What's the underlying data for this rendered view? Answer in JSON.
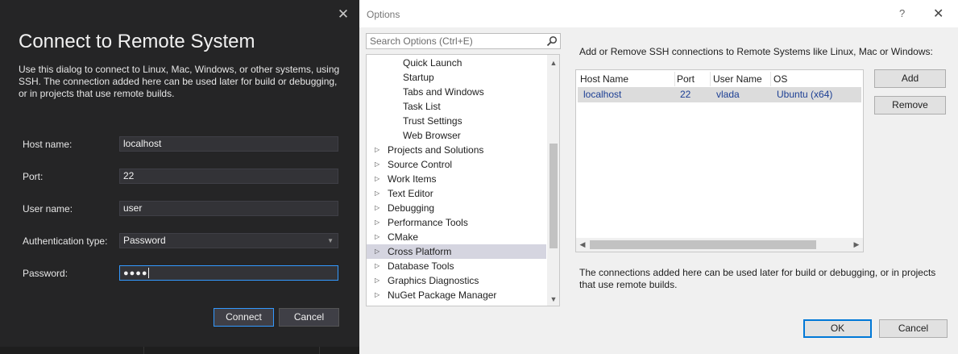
{
  "connect_dialog": {
    "close_glyph": "✕",
    "title": "Connect to Remote System",
    "description": "Use this dialog to connect to Linux, Mac, Windows, or other systems, using SSH. The connection added here can be used later for build or debugging, or in projects that use remote builds.",
    "fields": {
      "host_label": "Host name:",
      "host_value": "localhost",
      "port_label": "Port:",
      "port_value": "22",
      "user_label": "User name:",
      "user_value": "user",
      "auth_label": "Authentication type:",
      "auth_value": "Password",
      "password_label": "Password:",
      "password_value": "●●●●"
    },
    "connect_label": "Connect",
    "cancel_label": "Cancel"
  },
  "options_dialog": {
    "title": "Options",
    "help_glyph": "?",
    "close_glyph": "✕",
    "search_placeholder": "Search Options (Ctrl+E)",
    "tree": [
      {
        "label": "Quick Launch",
        "child": true
      },
      {
        "label": "Startup",
        "child": true
      },
      {
        "label": "Tabs and Windows",
        "child": true
      },
      {
        "label": "Task List",
        "child": true
      },
      {
        "label": "Trust Settings",
        "child": true
      },
      {
        "label": "Web Browser",
        "child": true
      },
      {
        "label": "Projects and Solutions",
        "child": false
      },
      {
        "label": "Source Control",
        "child": false
      },
      {
        "label": "Work Items",
        "child": false
      },
      {
        "label": "Text Editor",
        "child": false
      },
      {
        "label": "Debugging",
        "child": false
      },
      {
        "label": "Performance Tools",
        "child": false
      },
      {
        "label": "CMake",
        "child": false
      },
      {
        "label": "Cross Platform",
        "child": false,
        "selected": true
      },
      {
        "label": "Database Tools",
        "child": false
      },
      {
        "label": "Graphics Diagnostics",
        "child": false
      },
      {
        "label": "NuGet Package Manager",
        "child": false
      }
    ],
    "heading": "Add or Remove SSH connections to Remote Systems like Linux, Mac or Windows:",
    "columns": {
      "host": "Host Name",
      "port": "Port",
      "user": "User Name",
      "os": "OS"
    },
    "connections": [
      {
        "host": "localhost",
        "port": "22",
        "user": "vlada",
        "os": "Ubuntu (x64)"
      }
    ],
    "add_label": "Add",
    "remove_label": "Remove",
    "note": "The connections added here can be used later for build or debugging, or in projects that use remote builds.",
    "ok_label": "OK",
    "cancel_label": "Cancel"
  }
}
